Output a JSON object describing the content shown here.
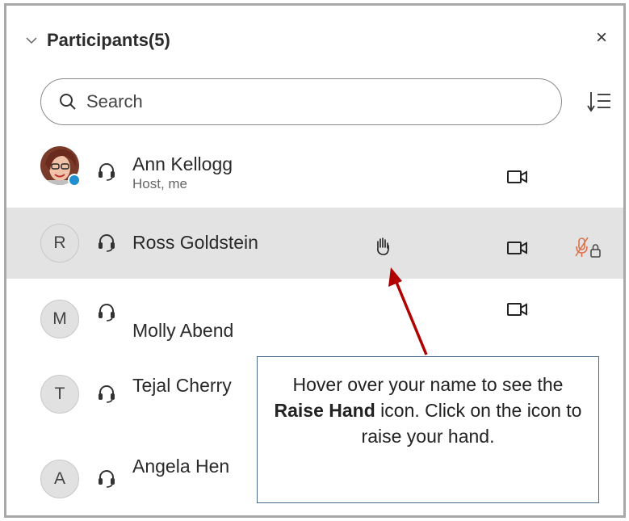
{
  "panel": {
    "title": "Participants(5)",
    "close_glyph": "×"
  },
  "search": {
    "placeholder": "Search"
  },
  "participants": [
    {
      "name": "Ann Kellogg",
      "subtitle": "Host, me",
      "avatar": "photo",
      "video": true
    },
    {
      "name": "Ross Goldstein",
      "initial": "R",
      "video": true,
      "raise_hand_visible": true,
      "mic": "muted-locked"
    },
    {
      "name": "Molly Abend",
      "initial": "M",
      "video": true
    },
    {
      "name": "Tejal Cherry",
      "initial": "T"
    },
    {
      "name": "Angela Hen",
      "initial": "A"
    }
  ],
  "callout": {
    "text_1": "Hover over your name to see the ",
    "bold": "Raise Hand",
    "text_2": " icon.  Click on the icon to raise your hand."
  },
  "colors": {
    "hover_row": "#e3e3e3",
    "arrow": "#b00000",
    "callout_border": "#4a6b8c",
    "mic_muted": "#e0704a"
  },
  "icons": [
    "chevron-down-icon",
    "close-icon",
    "search-icon",
    "sort-icon",
    "headset-icon",
    "video-camera-icon",
    "raise-hand-icon",
    "mic-muted-locked-icon"
  ]
}
